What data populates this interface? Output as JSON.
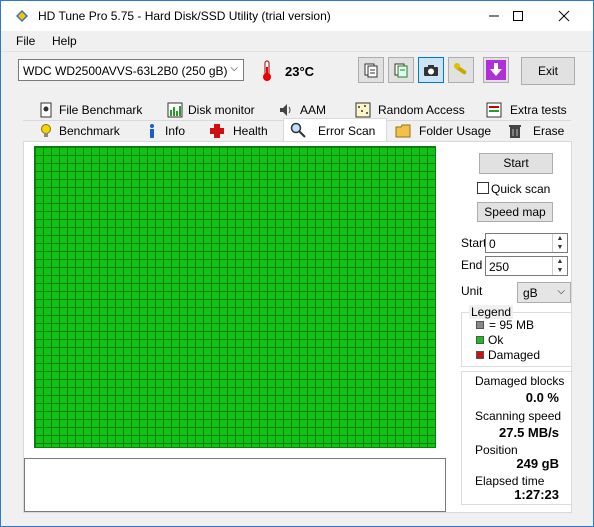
{
  "window": {
    "title": "HD Tune Pro 5.75 - Hard Disk/SSD Utility (trial version)"
  },
  "menu": {
    "file": "File",
    "help": "Help"
  },
  "toolbar": {
    "drive": "WDC WD2500AVVS-63L2B0 (250 gB)",
    "temperature": "23°C",
    "exit_label": "Exit"
  },
  "tabs": {
    "top": [
      "File Benchmark",
      "Disk monitor",
      "AAM",
      "Random Access",
      "Extra tests"
    ],
    "bottom": [
      "Benchmark",
      "Info",
      "Health",
      "Error Scan",
      "Folder Usage",
      "Erase"
    ],
    "active": "Error Scan"
  },
  "controls": {
    "start_label": "Start",
    "quick_scan_label": "Quick scan",
    "quick_scan_checked": false,
    "speed_map_label": "Speed map",
    "start_field_label": "Start",
    "start_value": "0",
    "end_field_label": "End",
    "end_value": "250",
    "unit_label": "Unit",
    "unit_value": "gB"
  },
  "legend": {
    "title": "Legend",
    "items": [
      {
        "label": "= 95 MB",
        "color": "#888888"
      },
      {
        "label": "Ok",
        "color": "#12c212"
      },
      {
        "label": "Damaged",
        "color": "#d01010"
      }
    ]
  },
  "stats": {
    "damaged_label": "Damaged blocks",
    "damaged_value": "0.0 %",
    "speed_label": "Scanning speed",
    "speed_value": "27.5 MB/s",
    "position_label": "Position",
    "position_value": "249 gB",
    "elapsed_label": "Elapsed time",
    "elapsed_value": "1:27:23"
  },
  "scan_grid": {
    "status": "Ok",
    "color": "#12c212"
  }
}
